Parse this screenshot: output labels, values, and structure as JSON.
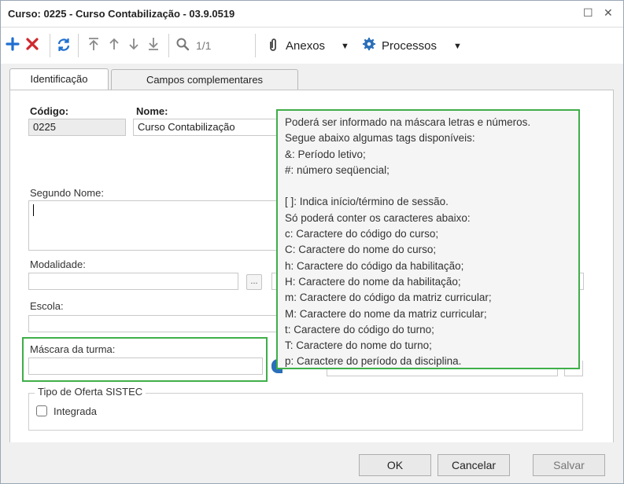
{
  "window": {
    "title": "Curso: 0225 - Curso Contabilização - 03.9.0519",
    "restore_glyph": "☐",
    "close_glyph": "✕"
  },
  "toolbar": {
    "page_indicator": "1/1",
    "anexos_label": "Anexos",
    "processos_label": "Processos",
    "icons": [
      "add-icon",
      "delete-icon",
      "refresh-icon",
      "first-record-icon",
      "previous-record-icon",
      "next-record-icon",
      "last-record-icon",
      "search-icon",
      "paperclip-icon",
      "gear-icon"
    ]
  },
  "tabs": [
    {
      "label": "Identificação",
      "active": true
    },
    {
      "label": "Campos complementares",
      "active": false
    }
  ],
  "form": {
    "codigo_label": "Código:",
    "codigo_value": "0225",
    "nome_label": "Nome:",
    "nome_value": "Curso Contabilização",
    "segundo_nome_label": "Segundo Nome:",
    "modalidade_label": "Modalidade:",
    "ellipsis": "...",
    "escola_label": "Escola:",
    "mascara_label": "Máscara da turma:",
    "mascara_value": "",
    "tipo_oferta_label": "Tipo de Oferta SISTEC",
    "integrada_label": "Integrada",
    "integrada_checked": false
  },
  "tooltip": {
    "lines": [
      "Poderá ser informado na máscara letras e números.",
      "Segue abaixo algumas tags disponíveis:",
      "&: Período letivo;",
      "#: número seqüencial;",
      "",
      "[ ]: Indica início/término de sessão.",
      "Só poderá conter os caracteres abaixo:",
      "c: Caractere do código do curso;",
      "C: Caractere do nome do curso;",
      "h: Caractere do código da habilitação;",
      "H: Caractere do nome da habilitação;",
      "m: Caractere do código da matriz curricular;",
      "M: Caractere do nome da matriz curricular;",
      "t: Caractere do código do turno;",
      "T: Caractere do nome do turno;",
      "p: Caractere do período da disciplina."
    ]
  },
  "footer": {
    "ok_label": "OK",
    "cancel_label": "Cancelar",
    "save_label": "Salvar"
  },
  "colors": {
    "highlight": "#3fae49",
    "add": "#1f6fd0",
    "delete": "#d0282e",
    "refresh": "#1f6fd0",
    "nav": "#8a8a8a"
  }
}
